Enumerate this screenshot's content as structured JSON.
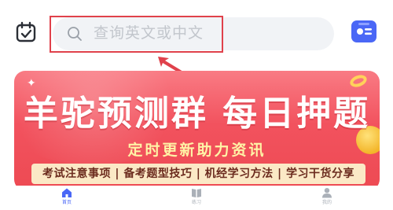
{
  "search": {
    "placeholder": "查询英文或中文"
  },
  "banner": {
    "title": "羊驼预测群  每日押题",
    "subtitle": "定时更新助力资讯",
    "tags": "考试注意事项 | 备考题型技巧 | 机经学习方法 | 学习干货分享"
  },
  "tabbar": {
    "tabs": [
      {
        "label": "首页",
        "icon": "home-icon",
        "active": true
      },
      {
        "label": "练习",
        "icon": "book-icon",
        "active": false
      },
      {
        "label": "我的",
        "icon": "user-icon",
        "active": false
      }
    ]
  },
  "colors": {
    "accent": "#4a67f6",
    "highlight_box": "#e0414b",
    "banner_red": "#f2525e",
    "banner_cream": "#fbe9c6",
    "banner_subtitle": "#fff3a6"
  }
}
